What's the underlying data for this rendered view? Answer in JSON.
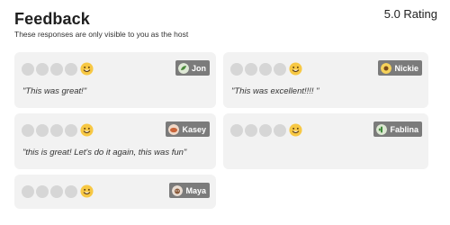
{
  "header": {
    "title": "Feedback",
    "subtitle": "These responses are only visible to you as the host",
    "rating": "5.0 Rating"
  },
  "cards": [
    {
      "name": "Jon",
      "avatar": "leaf-avatar-icon",
      "rating_emoji": "smiley-face-icon",
      "quote": "\"This was great!\""
    },
    {
      "name": "Nickie",
      "avatar": "sunflower-avatar-icon",
      "rating_emoji": "smiley-face-icon",
      "quote": "\"This was excellent!!!! \""
    },
    {
      "name": "Kasey",
      "avatar": "pastry-avatar-icon",
      "rating_emoji": "smiley-face-icon",
      "quote": "\"this is great! Let's do it again, this was fun\""
    },
    {
      "name": "Fablina",
      "avatar": "cactus-avatar-icon",
      "rating_emoji": "smiley-face-icon",
      "quote": ""
    },
    {
      "name": "Maya",
      "avatar": "pet-avatar-icon",
      "rating_emoji": "smiley-face-icon",
      "quote": ""
    }
  ],
  "colors": {
    "card_bg": "#f2f2f2",
    "tag_bg": "#7b7b7b",
    "empty_dot": "#d6d6d6",
    "emoji_yellow": "#f7c844"
  }
}
